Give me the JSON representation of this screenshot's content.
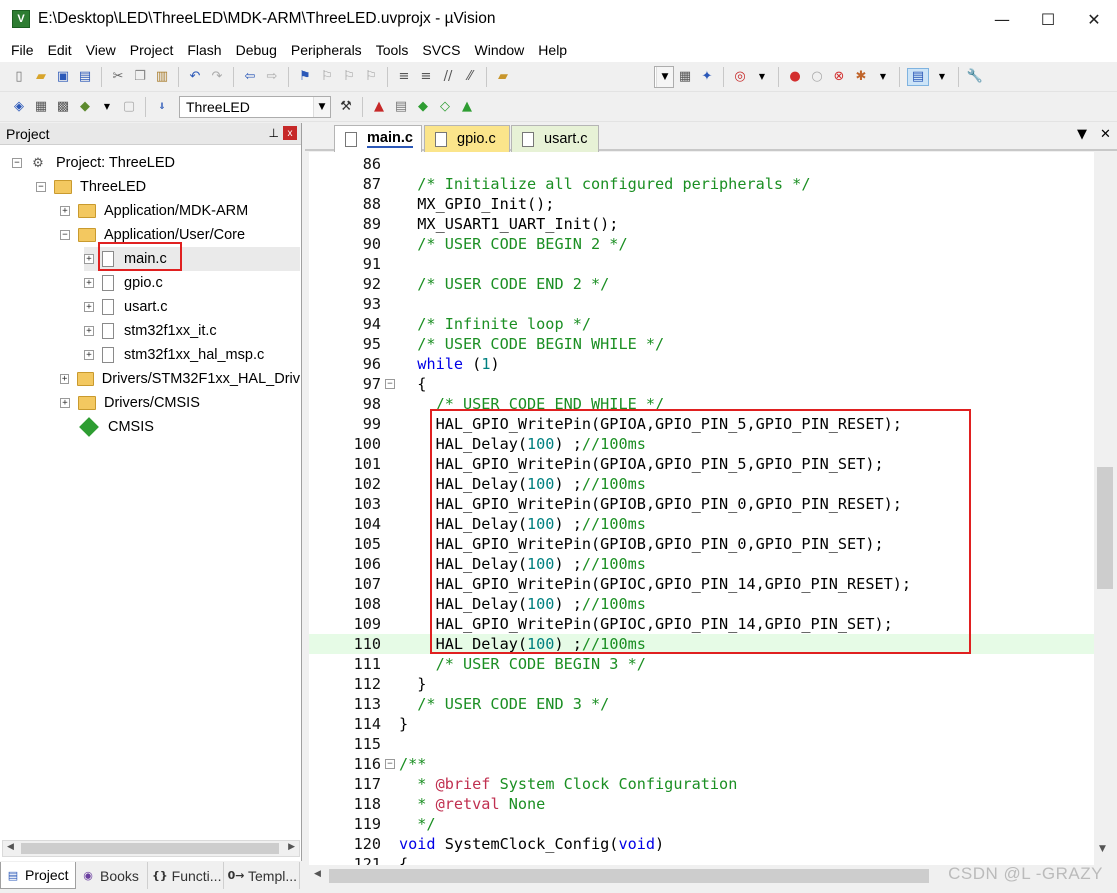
{
  "window": {
    "title": "E:\\Desktop\\LED\\ThreeLED\\MDK-ARM\\ThreeLED.uvprojx - µVision",
    "icon": "V",
    "minimize": "—",
    "maximize": "☐",
    "close": "✕"
  },
  "menu": [
    "File",
    "Edit",
    "View",
    "Project",
    "Flash",
    "Debug",
    "Peripherals",
    "Tools",
    "SVCS",
    "Window",
    "Help"
  ],
  "toolbar2": {
    "target": "ThreeLED"
  },
  "project_panel": {
    "title": "Project",
    "pin": "⊥",
    "close": "x",
    "tree": [
      {
        "label": "Project: ThreeLED",
        "exp": "−",
        "kind": "project"
      },
      {
        "label": "ThreeLED",
        "exp": "−",
        "kind": "folder"
      },
      {
        "label": "Application/MDK-ARM",
        "exp": "+",
        "kind": "folder"
      },
      {
        "label": "Application/User/Core",
        "exp": "−",
        "kind": "folder"
      },
      {
        "label": "main.c",
        "exp": "+",
        "kind": "file"
      },
      {
        "label": "gpio.c",
        "exp": "+",
        "kind": "file"
      },
      {
        "label": "usart.c",
        "exp": "+",
        "kind": "file"
      },
      {
        "label": "stm32f1xx_it.c",
        "exp": "+",
        "kind": "file"
      },
      {
        "label": "stm32f1xx_hal_msp.c",
        "exp": "+",
        "kind": "file"
      },
      {
        "label": "Drivers/STM32F1xx_HAL_Driv",
        "exp": "+",
        "kind": "folder"
      },
      {
        "label": "Drivers/CMSIS",
        "exp": "+",
        "kind": "folder"
      },
      {
        "label": "CMSIS",
        "exp": "",
        "kind": "cmsis"
      }
    ]
  },
  "bottom_tabs": [
    "Project",
    "Books",
    "Functi...",
    "Templ..."
  ],
  "editor_tabs": [
    "main.c",
    "gpio.c",
    "usart.c"
  ],
  "code": [
    {
      "n": "86",
      "t": ""
    },
    {
      "n": "87",
      "t": "  /* Initialize all configured peripherals */"
    },
    {
      "n": "88",
      "t": "  MX_GPIO_Init();"
    },
    {
      "n": "89",
      "t": "  MX_USART1_UART_Init();"
    },
    {
      "n": "90",
      "t": "  /* USER CODE BEGIN 2 */"
    },
    {
      "n": "91",
      "t": ""
    },
    {
      "n": "92",
      "t": "  /* USER CODE END 2 */"
    },
    {
      "n": "93",
      "t": ""
    },
    {
      "n": "94",
      "t": "  /* Infinite loop */"
    },
    {
      "n": "95",
      "t": "  /* USER CODE BEGIN WHILE */"
    },
    {
      "n": "96",
      "t": "  while (1)"
    },
    {
      "n": "97",
      "t": "  {"
    },
    {
      "n": "98",
      "t": "    /* USER CODE END WHILE */"
    },
    {
      "n": "99",
      "t": "    HAL_GPIO_WritePin(GPIOA,GPIO_PIN_5,GPIO_PIN_RESET);"
    },
    {
      "n": "100",
      "t": "    HAL_Delay(100) ;//100ms"
    },
    {
      "n": "101",
      "t": "    HAL_GPIO_WritePin(GPIOA,GPIO_PIN_5,GPIO_PIN_SET);"
    },
    {
      "n": "102",
      "t": "    HAL_Delay(100) ;//100ms"
    },
    {
      "n": "103",
      "t": "    HAL_GPIO_WritePin(GPIOB,GPIO_PIN_0,GPIO_PIN_RESET);"
    },
    {
      "n": "104",
      "t": "    HAL_Delay(100) ;//100ms"
    },
    {
      "n": "105",
      "t": "    HAL_GPIO_WritePin(GPIOB,GPIO_PIN_0,GPIO_PIN_SET);"
    },
    {
      "n": "106",
      "t": "    HAL_Delay(100) ;//100ms"
    },
    {
      "n": "107",
      "t": "    HAL_GPIO_WritePin(GPIOC,GPIO_PIN_14,GPIO_PIN_RESET);"
    },
    {
      "n": "108",
      "t": "    HAL_Delay(100) ;//100ms"
    },
    {
      "n": "109",
      "t": "    HAL_GPIO_WritePin(GPIOC,GPIO_PIN_14,GPIO_PIN_SET);"
    },
    {
      "n": "110",
      "t": "    HAL_Delay(100) ;//100ms"
    },
    {
      "n": "111",
      "t": "    /* USER CODE BEGIN 3 */"
    },
    {
      "n": "112",
      "t": "  }"
    },
    {
      "n": "113",
      "t": "  /* USER CODE END 3 */"
    },
    {
      "n": "114",
      "t": "}"
    },
    {
      "n": "115",
      "t": ""
    },
    {
      "n": "116",
      "t": "/**"
    },
    {
      "n": "117",
      "t": "  * @brief System Clock Configuration"
    },
    {
      "n": "118",
      "t": "  * @retval None"
    },
    {
      "n": "119",
      "t": "  */"
    },
    {
      "n": "120",
      "t": "void SystemClock_Config(void)"
    },
    {
      "n": "121",
      "t": "{"
    }
  ],
  "watermark": "CSDN @L -GRAZY"
}
